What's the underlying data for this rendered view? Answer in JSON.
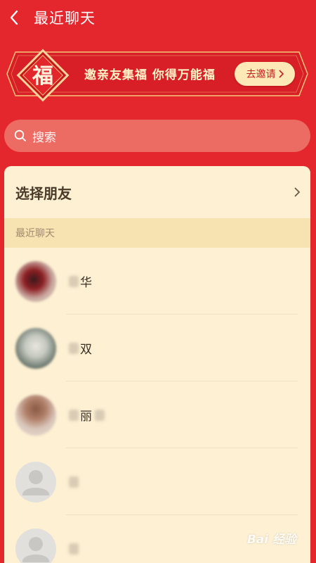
{
  "header": {
    "title": "最近聊天"
  },
  "banner": {
    "badge_char": "福",
    "text": "邀亲友集福 你得万能福",
    "invite_label": "去邀请"
  },
  "search": {
    "placeholder": "搜索"
  },
  "card": {
    "select_friends_label": "选择朋友",
    "section_title": "最近聊天",
    "contacts": [
      {
        "name_visible": "华",
        "avatar": "blurred-photo"
      },
      {
        "name_visible": "双",
        "avatar": "blurred-photo"
      },
      {
        "name_visible": "丽",
        "avatar": "blurred-photo"
      },
      {
        "name_visible": "",
        "avatar": "default"
      },
      {
        "name_visible": "",
        "avatar": "default"
      }
    ]
  },
  "watermark": {
    "text": "Bai 经验"
  },
  "colors": {
    "background": "#e4262d",
    "card": "#fdf0d3",
    "section": "#f7e2b2",
    "accent_text": "#fff3c8",
    "invite_bg": "#fde9b8"
  }
}
